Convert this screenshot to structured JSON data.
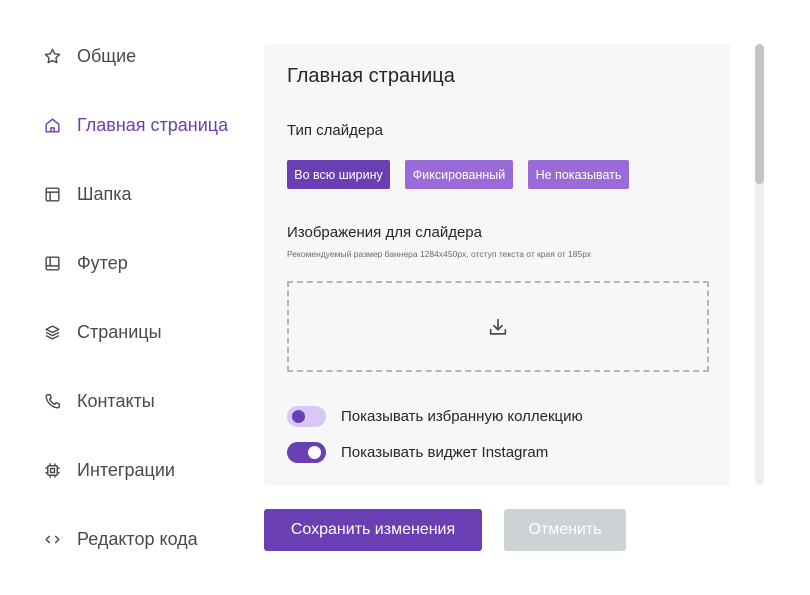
{
  "sidebar": {
    "items": [
      {
        "label": "Общие",
        "icon": "star-icon",
        "active": false
      },
      {
        "label": "Главная страница",
        "icon": "home-icon",
        "active": true
      },
      {
        "label": "Шапка",
        "icon": "header-layout-icon",
        "active": false
      },
      {
        "label": "Футер",
        "icon": "footer-layout-icon",
        "active": false
      },
      {
        "label": "Страницы",
        "icon": "layers-icon",
        "active": false
      },
      {
        "label": "Контакты",
        "icon": "phone-icon",
        "active": false
      },
      {
        "label": "Интеграции",
        "icon": "chip-icon",
        "active": false
      },
      {
        "label": "Редактор кода",
        "icon": "code-icon",
        "active": false
      }
    ]
  },
  "main": {
    "title": "Главная страница",
    "slider_type": {
      "label": "Тип слайдера",
      "options": [
        "Во всю ширину",
        "Фиксированный",
        "Не показывать"
      ],
      "selected": "Во всю ширину"
    },
    "slider_images": {
      "label": "Изображения для слайдера",
      "hint": "Рекомендуемый размер баннера 1284x450px, отступ текста от края от 185px",
      "upload_icon": "download-tray-icon"
    },
    "toggles": [
      {
        "label": "Показывать избранную коллекцию",
        "on": false
      },
      {
        "label": "Показывать виджет Instagram",
        "on": true
      }
    ]
  },
  "actions": {
    "save_label": "Сохранить изменения",
    "cancel_label": "Отменить"
  },
  "colors": {
    "accent": "#6a3fb3",
    "accent_light": "#9b6ad9",
    "toggle_off_track": "#d9c7f5",
    "panel_bg": "#f7f7f7",
    "cancel_bg": "#cdd2d4"
  }
}
